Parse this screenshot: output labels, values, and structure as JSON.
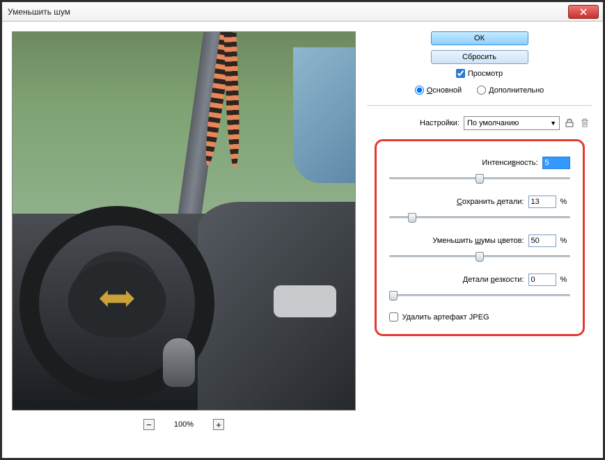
{
  "window": {
    "title": "Уменьшить шум"
  },
  "buttons": {
    "ok": "ОК",
    "reset": "Сбросить"
  },
  "preview_checkbox": "Просмотр",
  "mode": {
    "basic": "Основной",
    "advanced": "Дополнительно",
    "selected": "basic"
  },
  "settings": {
    "label": "Настройки:",
    "preset": "По умолчанию"
  },
  "params": {
    "strength": {
      "label": "Интенсивность:",
      "value": "5",
      "pct": 50
    },
    "preserve": {
      "label": "Сохранить детали:",
      "value": "13",
      "unit": "%",
      "pct": 13
    },
    "color": {
      "label": "Уменьшить шумы цветов:",
      "value": "50",
      "unit": "%",
      "pct": 50
    },
    "sharpen": {
      "label": "Детали резкости:",
      "value": "0",
      "unit": "%",
      "pct": 0
    }
  },
  "jpeg_artifact": "Удалить артефакт JPEG",
  "zoom": {
    "level": "100%"
  }
}
